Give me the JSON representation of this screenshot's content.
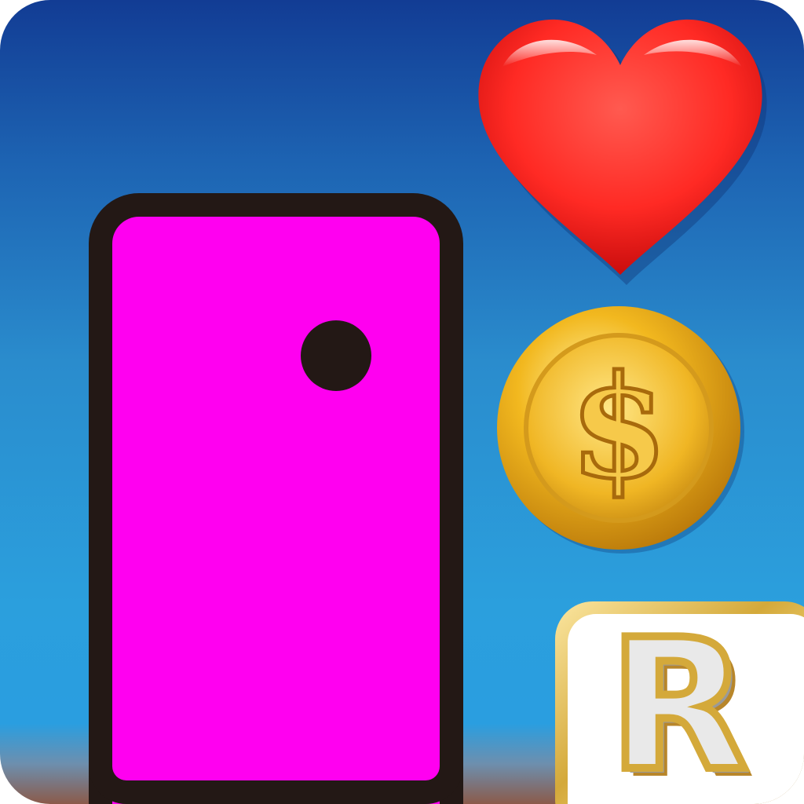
{
  "app_icon": {
    "badge": {
      "letter": "R",
      "icon": "r-badge-icon"
    },
    "card": {
      "icon": "phone-card-icon",
      "color": "#ff00f0",
      "outline_color": "#231815"
    },
    "heart": {
      "icon": "heart-icon",
      "color": "#ff2a24"
    },
    "coin": {
      "icon": "dollar-coin-icon",
      "symbol": "$",
      "color": "#f2b81f"
    },
    "background": {
      "top_color": "#123c94",
      "bottom_color": "#2a9ee0"
    }
  }
}
